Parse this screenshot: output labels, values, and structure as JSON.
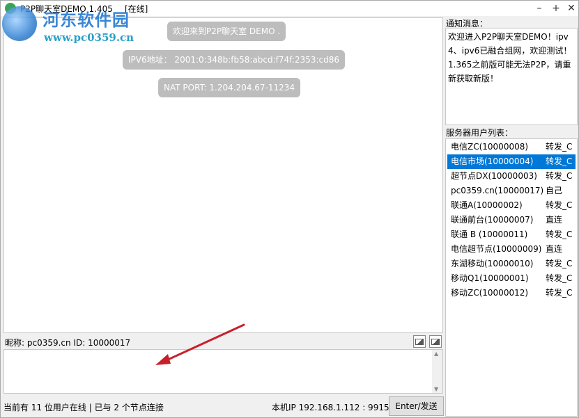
{
  "window": {
    "title": "P2P聊天室DEMO 1.405",
    "status": "[在线]",
    "min_glyph": "–",
    "max_glyph": "+",
    "close_glyph": "✕"
  },
  "watermark": {
    "title": "河东软件园",
    "url": "www.pc0359.cn"
  },
  "chat": {
    "messages": [
      "欢迎来到P2P聊天室 DEMO .",
      "IPV6地址： 2001:0:348b:fb58:abcd:f74f:2353:cd86",
      "NAT PORT: 1.204.204.67-11234"
    ]
  },
  "nick_bar": {
    "text": "昵称: pc0359.cn   ID: 10000017"
  },
  "input": {
    "value": ""
  },
  "status": {
    "left": "当前有 11 位用户在线 | 已与 2 个节点连接",
    "ip": "本机IP 192.168.1.112 : 9915",
    "send_label": "Enter/发送"
  },
  "notice": {
    "label": "通知消息：",
    "text": "欢迎进入P2P聊天室DEMO！ipv4、ipv6已融合组网，欢迎测试！1.365之前版可能无法P2P，请重新获取新版！"
  },
  "users": {
    "label": "服务器用户列表：",
    "selected_index": 1,
    "items": [
      {
        "name": "电信ZC(10000008)",
        "mode": "转发_C"
      },
      {
        "name": "电信市场(10000004)",
        "mode": "转发_C"
      },
      {
        "name": "超节点DX(10000003)",
        "mode": "转发_C"
      },
      {
        "name": "pc0359.cn(10000017)",
        "mode": "自己"
      },
      {
        "name": "联通A(10000002)",
        "mode": "转发_C"
      },
      {
        "name": "联通前台(10000007)",
        "mode": "直连"
      },
      {
        "name": "联通 B (10000011)",
        "mode": "转发_C"
      },
      {
        "name": "电信超节点(10000009)",
        "mode": "直连"
      },
      {
        "name": "东湖移动(10000010)",
        "mode": "转发_C"
      },
      {
        "name": "移动Q1(10000001)",
        "mode": "转发_C"
      },
      {
        "name": "移动ZC(10000012)",
        "mode": "转发_C"
      }
    ]
  },
  "colors": {
    "selection": "#0078d7",
    "bubble": "#bdbdbd",
    "arrow": "#c8202a"
  }
}
